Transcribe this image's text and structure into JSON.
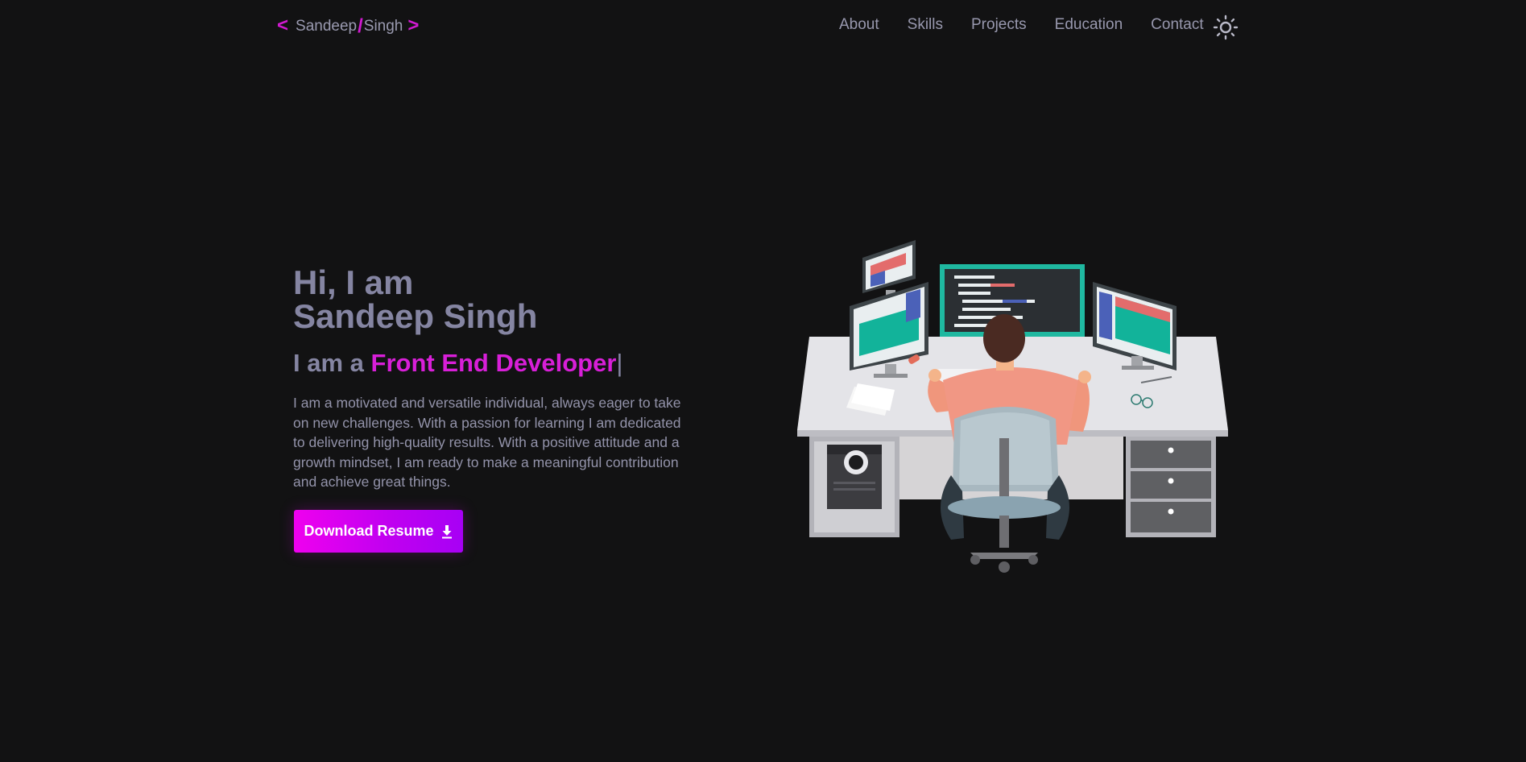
{
  "nav": {
    "logo": {
      "open": "<",
      "first": "Sandeep",
      "slash": "/",
      "last": "Singh",
      "close": ">"
    },
    "links": [
      "About",
      "Skills",
      "Projects",
      "Education",
      "Contact"
    ],
    "theme_icon": "sun-icon"
  },
  "hero": {
    "greeting": "Hi, I am",
    "name": "Sandeep Singh",
    "role_prefix": "I am a",
    "role": "Front End Developer",
    "cursor": "|",
    "description": "I am a motivated and versatile individual, always eager to take on new challenges. With a passion for learning I am dedicated to delivering high-quality results. With a positive attitude and a growth mindset, I am ready to make a meaningful contribution and achieve great things.",
    "button_label": "Download Resume",
    "button_icon": "download-icon"
  },
  "illustration": "developer-at-desk-illustration",
  "colors": {
    "background": "#121213",
    "accent": "#d81fd8",
    "text": "#8585a2",
    "button_gradient_start": "#ef00ef",
    "button_gradient_end": "#a700f5"
  }
}
